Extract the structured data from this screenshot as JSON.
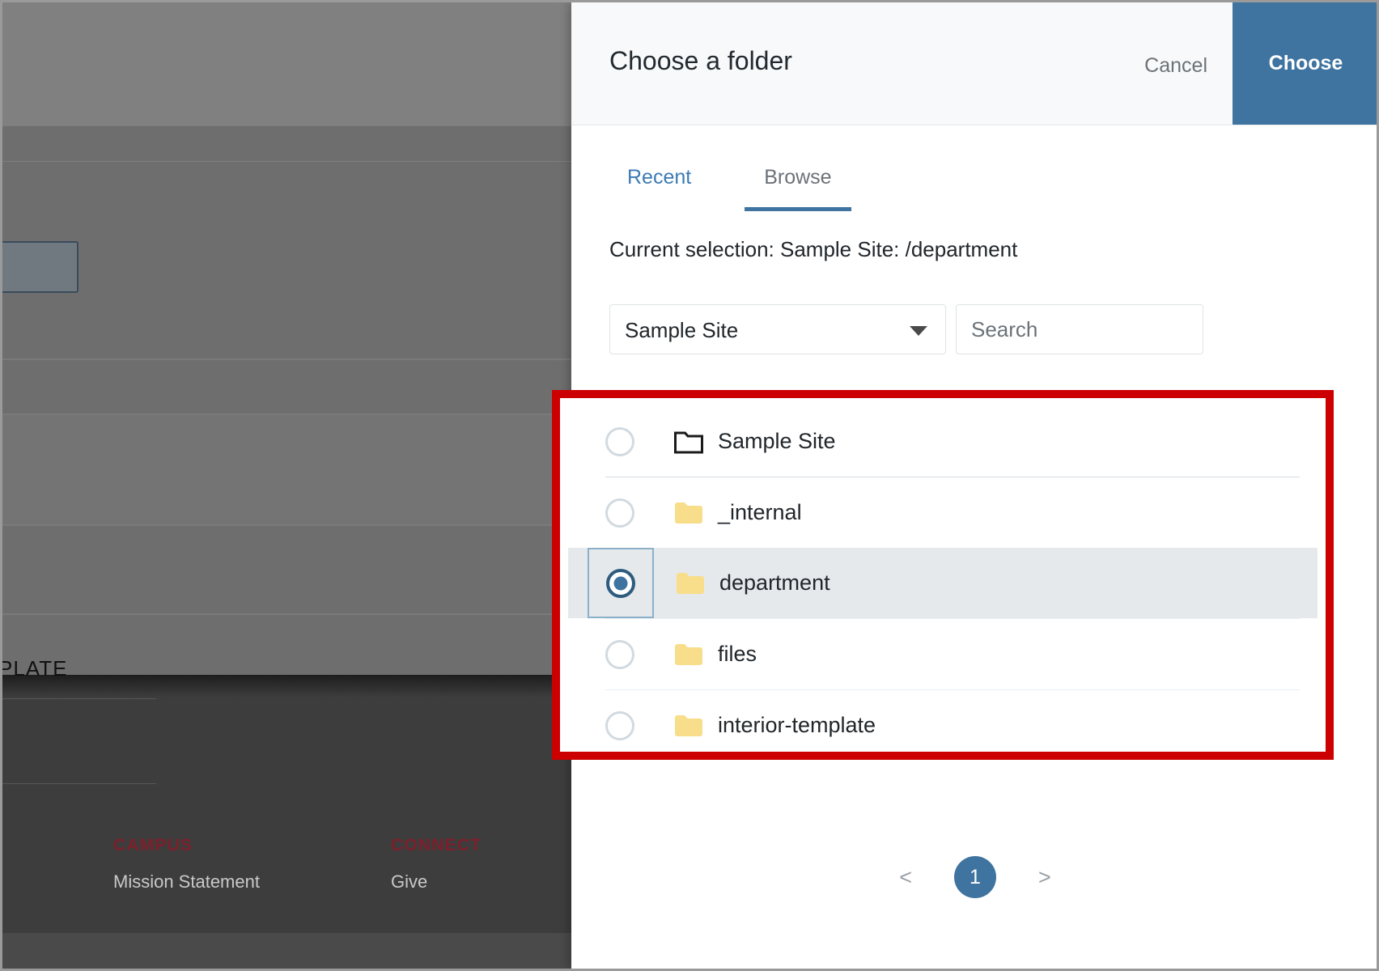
{
  "background_page": {
    "template_label": "PLATE",
    "footer_columns": [
      {
        "heading": "CAMPUS",
        "links": [
          "Mission Statement"
        ]
      },
      {
        "heading": "CONNECT",
        "links": [
          "Give"
        ]
      }
    ]
  },
  "dialog": {
    "title": "Choose a folder",
    "cancel_label": "Cancel",
    "choose_label": "Choose",
    "tabs": [
      {
        "label": "Recent",
        "active": false
      },
      {
        "label": "Browse",
        "active": true
      }
    ],
    "current_selection": "Current selection: Sample Site: /department",
    "site_select": {
      "value": "Sample Site",
      "caret_icon": "chevron-down-icon"
    },
    "search": {
      "value": "",
      "placeholder": "Search"
    },
    "folders": [
      {
        "label": "Sample Site",
        "icon": "folder-outline-icon",
        "selected": false
      },
      {
        "label": "_internal",
        "icon": "folder-icon",
        "selected": false
      },
      {
        "label": "department",
        "icon": "folder-icon",
        "selected": true
      },
      {
        "label": "files",
        "icon": "folder-icon",
        "selected": false
      },
      {
        "label": "interior-template",
        "icon": "folder-icon",
        "selected": false
      }
    ],
    "pagination": {
      "prev_label": "<",
      "next_label": ">",
      "current_page": "1"
    }
  },
  "colors": {
    "accent_blue": "#3f73a0",
    "link_blue": "#3c7ab5",
    "highlight_red": "#cc0000",
    "folder_yellow": "#f8dd8a",
    "row_selected_bg": "#e6e9eb",
    "footer_heading_red": "#7d1f2b"
  }
}
